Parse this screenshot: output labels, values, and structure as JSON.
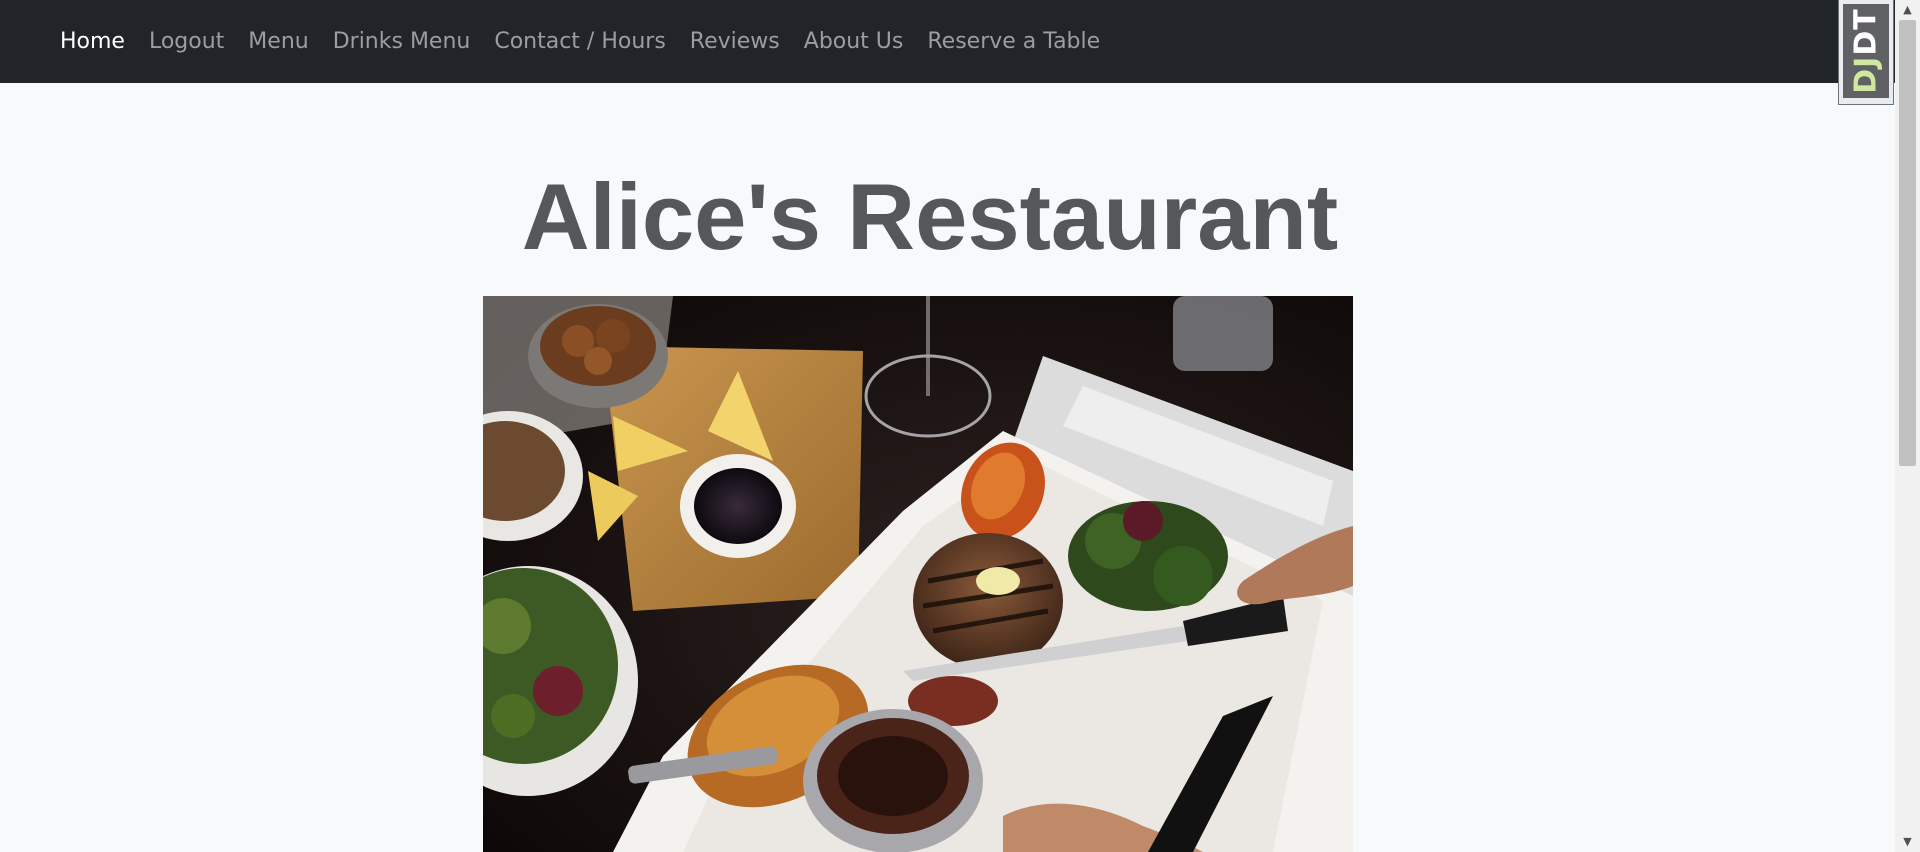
{
  "nav": {
    "items": [
      {
        "label": "Home",
        "active": true
      },
      {
        "label": "Logout",
        "active": false
      },
      {
        "label": "Menu",
        "active": false
      },
      {
        "label": "Drinks Menu",
        "active": false
      },
      {
        "label": "Contact / Hours",
        "active": false
      },
      {
        "label": "Reviews",
        "active": false
      },
      {
        "label": "About Us",
        "active": false
      },
      {
        "label": "Reserve a Table",
        "active": false
      }
    ]
  },
  "debug_toolbar": {
    "label_dj": "DJ",
    "label_dt": "DT"
  },
  "page": {
    "title": "Alice's Restaurant"
  },
  "colors": {
    "navbar": "#212529",
    "background": "#f8f9fa",
    "title": "#55575a",
    "nav_active": "#ffffff",
    "nav_inactive": "#9a9da1"
  }
}
